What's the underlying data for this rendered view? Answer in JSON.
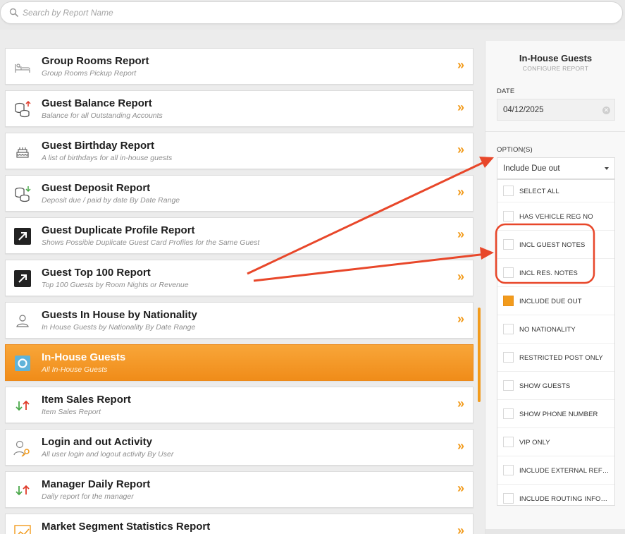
{
  "search": {
    "placeholder": "Search by Report Name",
    "icon": "search-icon"
  },
  "reports": [
    {
      "title": "Group Rooms Report",
      "sub": "Group Rooms Pickup Report",
      "icon": "bed-icon"
    },
    {
      "title": "Guest Balance Report",
      "sub": "Balance for all Outstanding Accounts",
      "icon": "coins-up-icon"
    },
    {
      "title": "Guest Birthday Report",
      "sub": "A list of birthdays for all in-house guests",
      "icon": "cake-icon"
    },
    {
      "title": "Guest Deposit Report",
      "sub": "Deposit due / paid by date By Date Range",
      "icon": "coins-down-icon"
    },
    {
      "title": "Guest Duplicate Profile Report",
      "sub": "Shows Possible Duplicate Guest Card Profiles for the Same Guest",
      "icon": "external-arrow-icon"
    },
    {
      "title": "Guest Top 100 Report",
      "sub": "Top 100 Guests by Room Nights or Revenue",
      "icon": "external-arrow-icon"
    },
    {
      "title": "Guests In House by Nationality",
      "sub": "In House Guests by Nationality By Date Range",
      "icon": "person-icon"
    },
    {
      "title": "In-House Guests",
      "sub": "All In-House Guests",
      "icon": "camera-icon",
      "active": true
    },
    {
      "title": "Item Sales Report",
      "sub": "Item Sales Report",
      "icon": "up-down-arrows-icon"
    },
    {
      "title": "Login and out Activity",
      "sub": "All user login and logout activity By User",
      "icon": "user-key-icon"
    },
    {
      "title": "Manager Daily Report",
      "sub": "Daily report for the manager",
      "icon": "up-down-arrows-icon"
    },
    {
      "title": "Market Segment Statistics Report",
      "sub": "",
      "icon": "chart-icon"
    }
  ],
  "chevron": "»",
  "panel": {
    "title": "In-House Guests",
    "subtitle": "CONFIGURE REPORT",
    "date_label": "DATE",
    "date_value": "04/12/2025",
    "options_label": "OPTION(S)",
    "select_value": "Include Due out",
    "options": [
      {
        "label": "SELECT ALL",
        "checked": false
      },
      {
        "label": "HAS VEHICLE REG NO",
        "checked": false
      },
      {
        "label": "INCL GUEST NOTES",
        "checked": false
      },
      {
        "label": "INCL RES. NOTES",
        "checked": false
      },
      {
        "label": "INCLUDE DUE OUT",
        "checked": true
      },
      {
        "label": "NO NATIONALITY",
        "checked": false
      },
      {
        "label": "RESTRICTED POST ONLY",
        "checked": false
      },
      {
        "label": "SHOW GUESTS",
        "checked": false
      },
      {
        "label": "SHOW PHONE NUMBER",
        "checked": false
      },
      {
        "label": "VIP ONLY",
        "checked": false
      },
      {
        "label": "INCLUDE EXTERNAL REFERENCE",
        "checked": false
      },
      {
        "label": "INCLUDE ROUTING INFORMATION",
        "checked": false
      }
    ]
  },
  "colors": {
    "accent": "#f29b1c",
    "annotation": "#e8472a"
  }
}
